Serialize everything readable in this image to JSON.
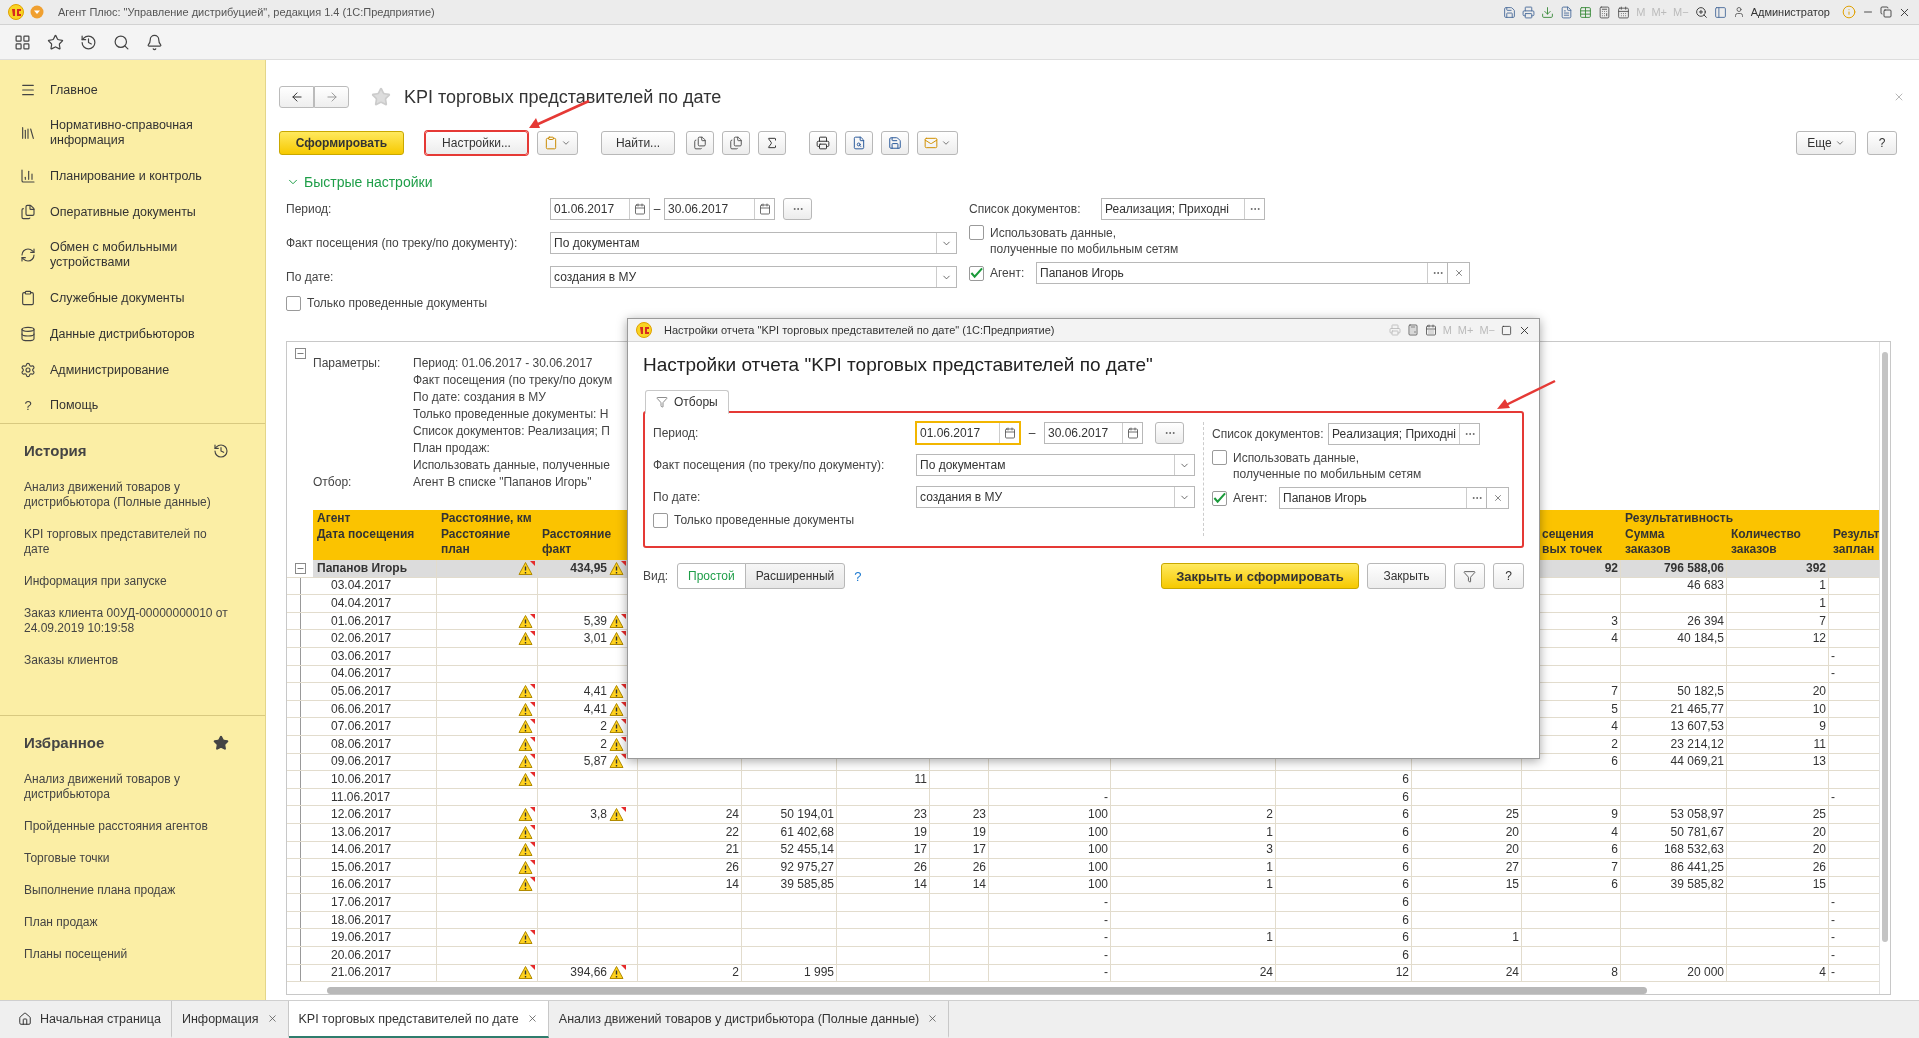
{
  "window": {
    "title": "Агент Плюс: \"Управление дистрибуцией\", редакция 1.4  (1С:Предприятие)",
    "memory_buttons": [
      "M",
      "M+",
      "M−"
    ],
    "user": "Администратор"
  },
  "sidebar": {
    "sections": [
      {
        "label": "Главное"
      },
      {
        "label": "Нормативно-справочная информация"
      },
      {
        "label": "Планирование и контроль"
      },
      {
        "label": "Оперативные документы"
      },
      {
        "label": "Обмен с мобильными устройствами"
      },
      {
        "label": "Служебные документы"
      },
      {
        "label": "Данные дистрибьюторов"
      },
      {
        "label": "Администрирование"
      },
      {
        "label": "Помощь",
        "glyph": "?"
      }
    ],
    "history": {
      "title": "История",
      "items": [
        "Анализ движений товаров у дистрибьютора (Полные данные)",
        "KPI торговых представителей по дате",
        "Информация при запуске",
        "Заказ клиента 00УД-00000000010 от 24.09.2019 10:19:58",
        "Заказы клиентов"
      ]
    },
    "favorites": {
      "title": "Избранное",
      "items": [
        "Анализ движений товаров у дистрибьютора",
        "Пройденные расстояния агентов",
        "Торговые точки",
        "Выполнение плана продаж",
        "План продаж",
        "Планы посещений"
      ]
    }
  },
  "form": {
    "title": "KPI торговых представителей по дате",
    "buttons": {
      "generate": "Сформировать",
      "settings": "Настройки...",
      "find": "Найти...",
      "more": "Еще",
      "help": "?"
    },
    "quick_settings": {
      "title": "Быстрые настройки",
      "expanded": true,
      "period": {
        "label": "Период:",
        "from": "01.06.2017",
        "separator": "–",
        "to": "30.06.2017",
        "focused": false
      },
      "visit_fact": {
        "label": "Факт посещения (по треку/по документу):",
        "value": "По документам"
      },
      "by_date": {
        "label": "По дате:",
        "value": "создания в МУ"
      },
      "posted_only": {
        "label": "Только проведенные документы",
        "checked": false
      },
      "documents": {
        "label": "Список документов:",
        "value": "Реализация; Приходні"
      },
      "mobile_data": {
        "label": "Использовать данные, полученные по мобильным сетям",
        "checked": false
      },
      "agent": {
        "label": "Агент:",
        "checked": true,
        "value": "Папанов Игорь"
      }
    }
  },
  "report": {
    "parameters": {
      "label": "Параметры:",
      "lines": [
        "Период: 01.06.2017 - 30.06.2017",
        "Факт посещения (по треку/по докум",
        "По дате: создания в МУ",
        "Только проведенные документы: Н",
        "Список документов: Реализация; П",
        "План продаж:",
        "Использовать данные, полученные"
      ]
    },
    "filter": {
      "label": "Отбор:",
      "value": "Агент В списке \"Папанов Игорь\""
    },
    "header": {
      "agent": "Агент",
      "distance_group": "Расстояние, км",
      "results_group": "Результативность",
      "columns": [
        "Дата посещения",
        "Расстояние план",
        "Расстояние факт",
        "сещения вых точек",
        "Сумма заказов",
        "Количество заказов",
        "Результ заплан"
      ]
    },
    "rows": [
      {
        "label": "Папанов Игорь",
        "kind": "group",
        "plan_warning": true,
        "fact": "434,95",
        "fact_warning": true,
        "cells": [
          null,
          null,
          null,
          null,
          null,
          null,
          null,
          null,
          "92",
          "796 588,06",
          "392",
          null
        ]
      },
      {
        "label": "03.04.2017",
        "kind": "date",
        "plan_warning": false,
        "fact": null,
        "fact_warning": false,
        "cells": [
          null,
          null,
          null,
          null,
          null,
          null,
          null,
          null,
          null,
          "46 683",
          "1",
          null
        ]
      },
      {
        "label": "04.04.2017",
        "kind": "date",
        "plan_warning": false,
        "fact": null,
        "fact_warning": false,
        "cells": [
          null,
          null,
          null,
          null,
          null,
          null,
          null,
          null,
          null,
          null,
          "1",
          null
        ]
      },
      {
        "label": "01.06.2017",
        "kind": "date",
        "plan_warning": true,
        "fact": "5,39",
        "fact_warning": true,
        "cells": [
          null,
          null,
          null,
          null,
          null,
          null,
          null,
          null,
          "3",
          "26 394",
          "7",
          null
        ]
      },
      {
        "label": "02.06.2017",
        "kind": "date",
        "plan_warning": true,
        "fact": "3,01",
        "fact_warning": true,
        "cells": [
          null,
          null,
          null,
          null,
          null,
          null,
          null,
          null,
          "4",
          "40 184,5",
          "12",
          null
        ]
      },
      {
        "label": "03.06.2017",
        "kind": "date",
        "plan_warning": false,
        "fact": null,
        "fact_warning": false,
        "cells": [
          null,
          null,
          null,
          null,
          null,
          null,
          null,
          null,
          null,
          null,
          null,
          "-"
        ]
      },
      {
        "label": "04.06.2017",
        "kind": "date",
        "plan_warning": false,
        "fact": null,
        "fact_warning": false,
        "cells": [
          null,
          null,
          null,
          null,
          null,
          null,
          null,
          null,
          null,
          null,
          null,
          "-"
        ]
      },
      {
        "label": "05.06.2017",
        "kind": "date",
        "plan_warning": true,
        "fact": "4,41",
        "fact_warning": true,
        "cells": [
          null,
          null,
          null,
          null,
          null,
          null,
          null,
          null,
          "7",
          "50 182,5",
          "20",
          null
        ]
      },
      {
        "label": "06.06.2017",
        "kind": "date",
        "plan_warning": true,
        "fact": "4,41",
        "fact_warning": true,
        "cells": [
          null,
          null,
          null,
          null,
          null,
          null,
          null,
          null,
          "5",
          "21 465,77",
          "10",
          null
        ]
      },
      {
        "label": "07.06.2017",
        "kind": "date",
        "plan_warning": true,
        "fact": "2",
        "fact_warning": true,
        "cells": [
          null,
          null,
          null,
          null,
          null,
          null,
          null,
          null,
          "4",
          "13 607,53",
          "9",
          null
        ]
      },
      {
        "label": "08.06.2017",
        "kind": "date",
        "plan_warning": true,
        "fact": "2",
        "fact_warning": true,
        "cells": [
          null,
          null,
          null,
          null,
          null,
          null,
          null,
          null,
          "2",
          "23 214,12",
          "11",
          null
        ]
      },
      {
        "label": "09.06.2017",
        "kind": "date",
        "plan_warning": true,
        "fact": "5,87",
        "fact_warning": true,
        "cells": [
          null,
          null,
          null,
          null,
          null,
          null,
          null,
          null,
          "6",
          "44 069,21",
          "13",
          null
        ]
      },
      {
        "label": "10.06.2017",
        "kind": "date",
        "plan_warning": true,
        "fact": null,
        "fact_warning": false,
        "cells": [
          null,
          null,
          "11",
          null,
          null,
          null,
          "6",
          null,
          null,
          null,
          null,
          null
        ]
      },
      {
        "label": "11.06.2017",
        "kind": "date",
        "plan_warning": false,
        "fact": null,
        "fact_warning": false,
        "cells": [
          null,
          null,
          null,
          null,
          "-",
          null,
          "6",
          null,
          null,
          null,
          null,
          "-"
        ]
      },
      {
        "label": "12.06.2017",
        "kind": "date",
        "plan_warning": true,
        "fact": "3,8",
        "fact_warning": true,
        "cells": [
          "24",
          "50 194,01",
          "23",
          "23",
          "100",
          "2",
          "6",
          "25",
          "9",
          "53 058,97",
          "25",
          null
        ]
      },
      {
        "label": "13.06.2017",
        "kind": "date",
        "plan_warning": true,
        "fact": null,
        "fact_warning": false,
        "cells": [
          "22",
          "61 402,68",
          "19",
          "19",
          "100",
          "1",
          "6",
          "20",
          "4",
          "50 781,67",
          "20",
          null
        ]
      },
      {
        "label": "14.06.2017",
        "kind": "date",
        "plan_warning": true,
        "fact": null,
        "fact_warning": false,
        "cells": [
          "21",
          "52 455,14",
          "17",
          "17",
          "100",
          "3",
          "6",
          "20",
          "6",
          "168 532,63",
          "20",
          null
        ]
      },
      {
        "label": "15.06.2017",
        "kind": "date",
        "plan_warning": true,
        "fact": null,
        "fact_warning": false,
        "cells": [
          "26",
          "92 975,27",
          "26",
          "26",
          "100",
          "1",
          "6",
          "27",
          "7",
          "86 441,25",
          "26",
          null
        ]
      },
      {
        "label": "16.06.2017",
        "kind": "date",
        "plan_warning": true,
        "fact": null,
        "fact_warning": false,
        "cells": [
          "14",
          "39 585,85",
          "14",
          "14",
          "100",
          "1",
          "6",
          "15",
          "6",
          "39 585,82",
          "15",
          null
        ]
      },
      {
        "label": "17.06.2017",
        "kind": "date",
        "plan_warning": false,
        "fact": null,
        "fact_warning": false,
        "cells": [
          null,
          null,
          null,
          null,
          "-",
          null,
          "6",
          null,
          null,
          null,
          null,
          "-"
        ]
      },
      {
        "label": "18.06.2017",
        "kind": "date",
        "plan_warning": false,
        "fact": null,
        "fact_warning": false,
        "cells": [
          null,
          null,
          null,
          null,
          "-",
          null,
          "6",
          null,
          null,
          null,
          null,
          "-"
        ]
      },
      {
        "label": "19.06.2017",
        "kind": "date",
        "plan_warning": true,
        "fact": null,
        "fact_warning": false,
        "cells": [
          null,
          null,
          null,
          null,
          "-",
          "1",
          "6",
          "1",
          null,
          null,
          null,
          "-"
        ]
      },
      {
        "label": "20.06.2017",
        "kind": "date",
        "plan_warning": false,
        "fact": null,
        "fact_warning": false,
        "cells": [
          null,
          null,
          null,
          null,
          "-",
          null,
          "6",
          null,
          null,
          null,
          null,
          "-"
        ]
      },
      {
        "label": "21.06.2017",
        "kind": "date",
        "plan_warning": true,
        "fact": "394,66",
        "fact_warning": true,
        "cells": [
          "2",
          "1 995",
          null,
          null,
          "-",
          "24",
          "12",
          "24",
          "8",
          "20 000",
          "4",
          "-"
        ]
      }
    ]
  },
  "dialog": {
    "title": "Настройки отчета \"KPI торговых представителей по дате\"  (1С:Предприятие)",
    "memory_buttons": [
      "M",
      "M+",
      "M−"
    ],
    "heading": "Настройки отчета \"KPI торговых представителей по дате\"",
    "tabs": [
      {
        "label": "Отборы",
        "selected": true
      }
    ],
    "period": {
      "label": "Период:",
      "from": "01.06.2017",
      "separator": "–",
      "to": "30.06.2017",
      "focused": true
    },
    "visit_fact": {
      "label": "Факт посещения (по треку/по документу):",
      "value": "По документам"
    },
    "by_date": {
      "label": "По дате:",
      "value": "создания в МУ"
    },
    "posted_only": {
      "label": "Только проведенные документы",
      "checked": false
    },
    "documents": {
      "label": "Список документов:",
      "value": "Реализация; Приходні"
    },
    "mobile_data": {
      "label": "Использовать данные, полученные по мобильным сетям",
      "checked": false
    },
    "agent": {
      "label": "Агент:",
      "checked": true,
      "value": "Папанов Игорь"
    },
    "view": {
      "label": "Вид:",
      "options": [
        {
          "label": "Простой",
          "selected": true
        },
        {
          "label": "Расширенный",
          "selected": false
        }
      ],
      "help": "?"
    },
    "buttons": {
      "apply": "Закрыть и сформировать",
      "close": "Закрыть",
      "help": "?"
    }
  },
  "open_tabs": [
    {
      "label": "Начальная страница",
      "selected": false,
      "closable": false
    },
    {
      "label": "Информация",
      "selected": false,
      "closable": true
    },
    {
      "label": "KPI торговых представителей по дате",
      "selected": true,
      "closable": true
    },
    {
      "label": "Анализ движений товаров у дистрибьютора (Полные данные)",
      "selected": false,
      "closable": true
    }
  ]
}
